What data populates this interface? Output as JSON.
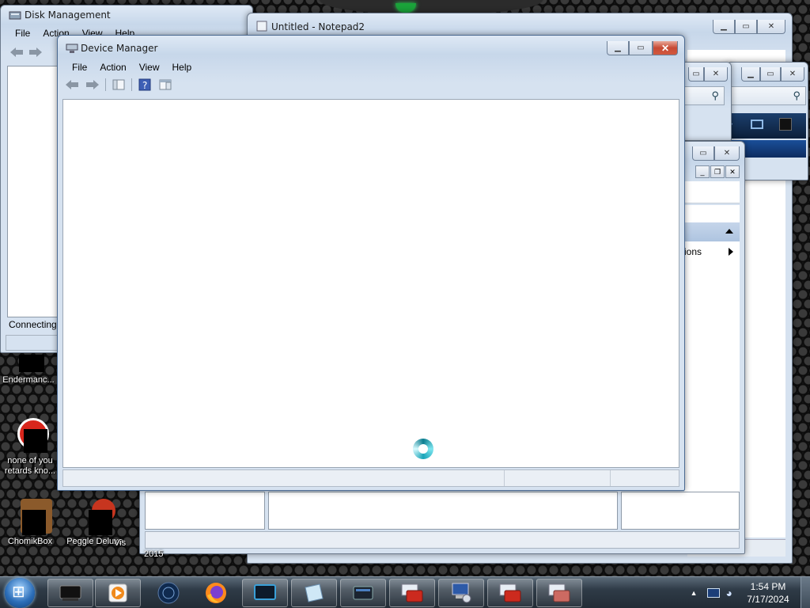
{
  "windows": {
    "disk_management": {
      "title": "Disk Management",
      "menu": [
        "File",
        "Action",
        "View",
        "Help"
      ],
      "status": "Connecting"
    },
    "notepad": {
      "title": "Untitled - Notepad2"
    },
    "device_manager": {
      "title": "Device Manager",
      "menu": [
        "File",
        "Action",
        "View",
        "Help"
      ],
      "state": "loading"
    },
    "panel_window": {
      "task_item_partial": "ions"
    }
  },
  "desktop_icons": [
    {
      "label": "Endermanc..."
    },
    {
      "label": "none of you retards kno..."
    },
    {
      "label": "ChomikBox"
    },
    {
      "label": "Peggle Deluxe"
    },
    {
      "label": "Vis"
    },
    {
      "label": "2015"
    }
  ],
  "taskbar": {
    "items": [
      "terminal-app",
      "media-player",
      "globe-app",
      "firefox",
      "monitor-app",
      "notepad2",
      "window-app",
      "toolbox-app",
      "device-manager",
      "toolbox-app-2",
      "toolbox-app-3"
    ],
    "clock": {
      "time": "1:54 PM",
      "date": "7/17/2024"
    }
  },
  "colors": {
    "window_frame": "#c7d7ea",
    "close_button": "#c74a34",
    "taskbar": "#2f3b47",
    "spinner": "#19a4b8"
  }
}
